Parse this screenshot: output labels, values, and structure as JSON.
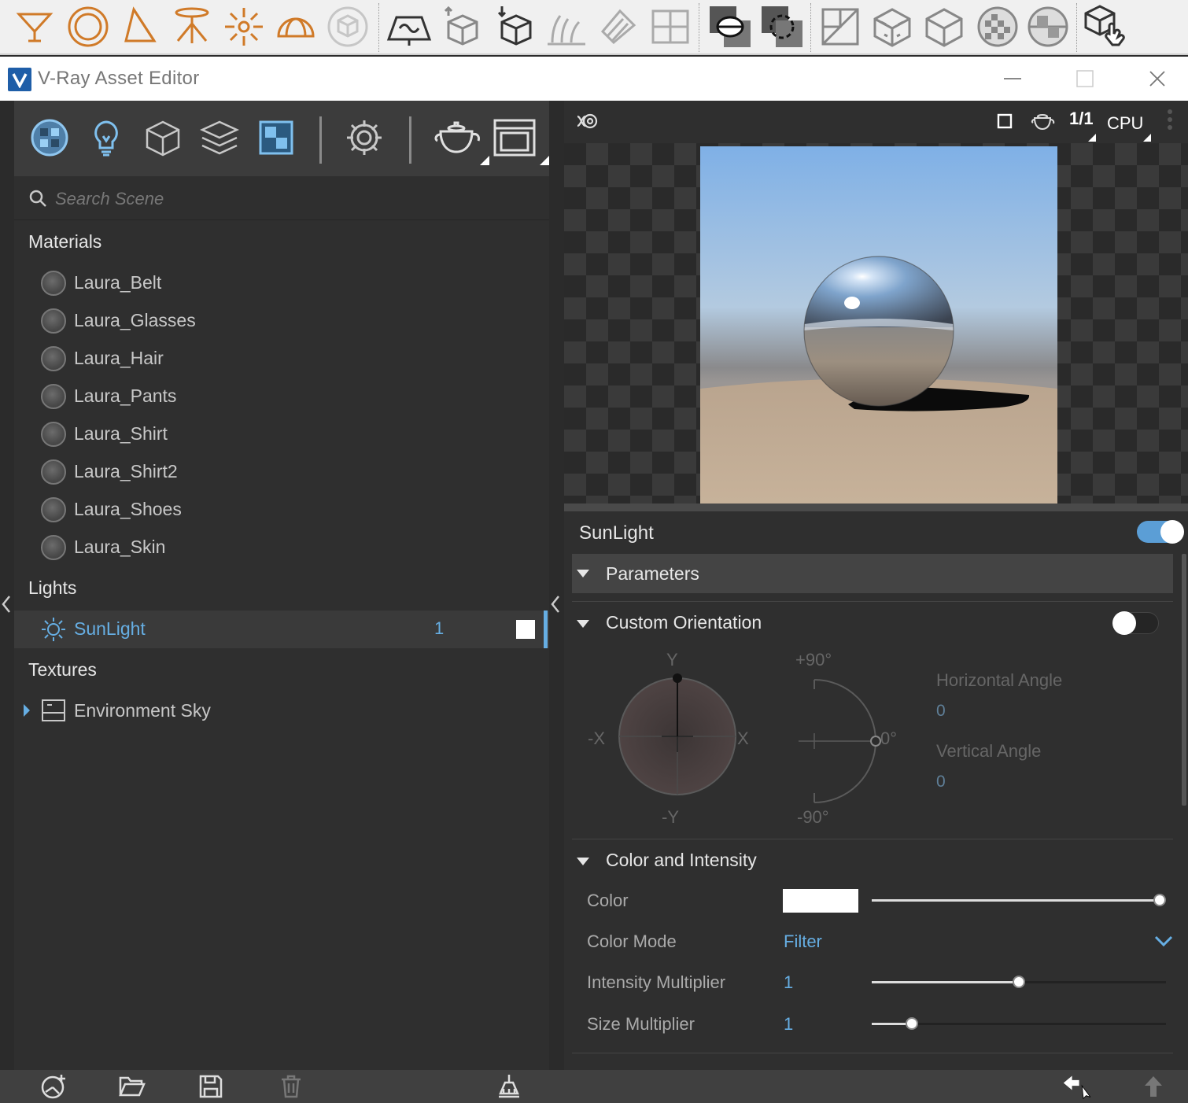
{
  "window": {
    "title": "V-Ray Asset Editor"
  },
  "top_toolbar": {
    "icons": [
      "omni-light-icon",
      "sphere-light-icon",
      "spot-light-icon",
      "ies-light-icon",
      "omni-point-light-icon",
      "dome-light-icon",
      "mesh-light-icon",
      "infinite-plane-icon",
      "export-proxy-icon",
      "import-proxy-icon",
      "fur-icon",
      "mesh-clipper-icon",
      "scene-icon",
      "v-ray-mtl-icon",
      "tex-to-scene-icon",
      "uvw-icon",
      "uvw-random-icon",
      "tri-planar-icon",
      "checker-icon",
      "sphere-fade-icon",
      "click-to-select-icon"
    ]
  },
  "left_panel": {
    "category_icons": [
      "materials-icon",
      "lights-icon",
      "geometry-icon",
      "render-elements-icon",
      "textures-icon",
      "settings-icon",
      "render-icon",
      "frame-buffer-icon"
    ],
    "search": {
      "placeholder": "Search Scene",
      "value": ""
    },
    "sections": {
      "materials": {
        "label": "Materials",
        "items": [
          "Laura_Belt",
          "Laura_Glasses",
          "Laura_Hair",
          "Laura_Pants",
          "Laura_Shirt",
          "Laura_Shirt2",
          "Laura_Shoes",
          "Laura_Skin"
        ]
      },
      "lights": {
        "label": "Lights",
        "items": [
          {
            "name": "SunLight",
            "count": "1",
            "color": "#ffffff",
            "selected": true
          }
        ]
      },
      "textures": {
        "label": "Textures",
        "items": [
          {
            "name": "Environment Sky",
            "expanded": false
          }
        ]
      }
    }
  },
  "preview": {
    "toolbar": {
      "resolution_label": "1/1",
      "engine_label": "CPU"
    }
  },
  "light_params": {
    "title": "SunLight",
    "enabled": true,
    "sections": {
      "parameters": {
        "label": "Parameters"
      },
      "custom_orientation": {
        "label": "Custom Orientation",
        "enabled": false,
        "axis_labels": {
          "y": "Y",
          "neg_y": "-Y",
          "x": "X",
          "neg_x": "-X"
        },
        "angle_labels": {
          "top": "+90°",
          "mid": "0°",
          "bottom": "-90°"
        },
        "horizontal_angle": {
          "label": "Horizontal Angle",
          "value": "0"
        },
        "vertical_angle": {
          "label": "Vertical Angle",
          "value": "0"
        }
      },
      "color_intensity": {
        "label": "Color and Intensity",
        "color": {
          "label": "Color",
          "swatch": "#ffffff",
          "slider": 1.0
        },
        "color_mode": {
          "label": "Color Mode",
          "value": "Filter"
        },
        "intensity_multiplier": {
          "label": "Intensity Multiplier",
          "value": "1",
          "slider": 0.5
        },
        "size_multiplier": {
          "label": "Size Multiplier",
          "value": "1",
          "slider": 0.12
        }
      }
    }
  },
  "bottom_bar": {
    "icons": [
      "add-asset-icon",
      "open-file-icon",
      "save-icon",
      "delete-icon",
      "purge-icon",
      "back-arrow-icon",
      "up-arrow-icon"
    ]
  },
  "colors": {
    "accent_blue": "#66aee3",
    "toolbar_orange": "#d07a28",
    "panel_bg": "#2f2f2f"
  }
}
